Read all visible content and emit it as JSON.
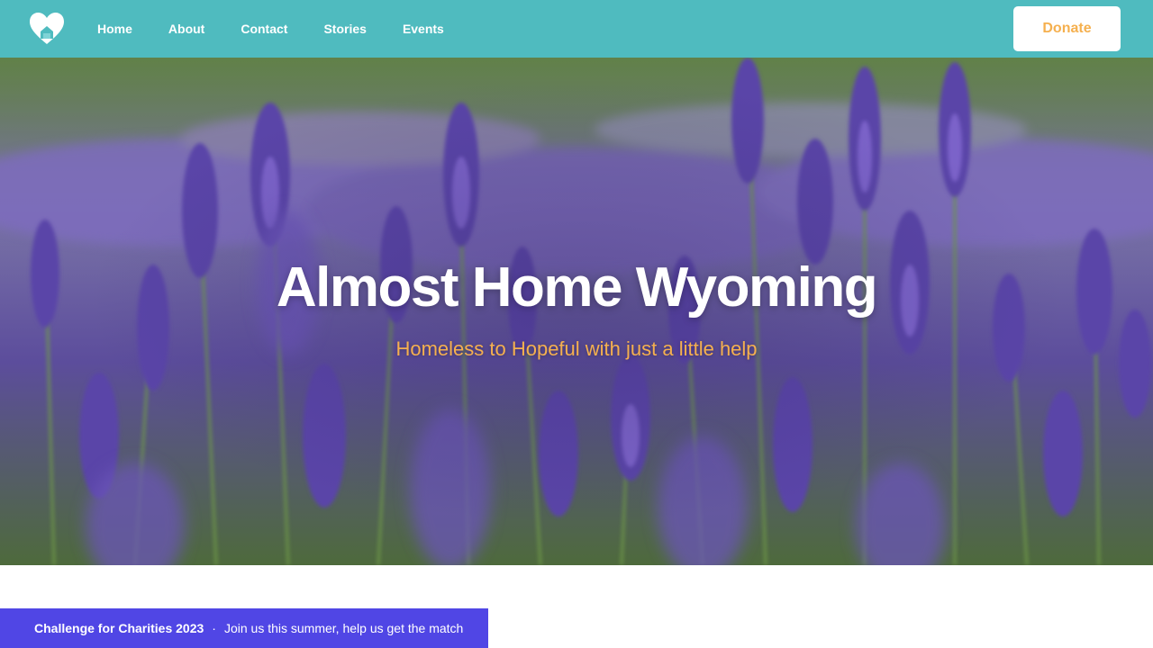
{
  "nav": {
    "logo_icon": "heart-home-icon",
    "links": [
      "Home",
      "About",
      "Contact",
      "Stories",
      "Events"
    ],
    "donate_label": "Donate"
  },
  "hero": {
    "title": "Almost Home Wyoming",
    "subtitle": "Homeless to Hopeful with just a little help",
    "background": "lavender-field-photo"
  },
  "banner": {
    "title": "Challenge for Charities 2023",
    "separator": "·",
    "text": "Join us this summer, help us get the match"
  },
  "colors": {
    "nav_bg": "#4fbbbf",
    "accent": "#f5b04f",
    "banner_bg": "#5046e5",
    "text_light": "#ffffff"
  }
}
